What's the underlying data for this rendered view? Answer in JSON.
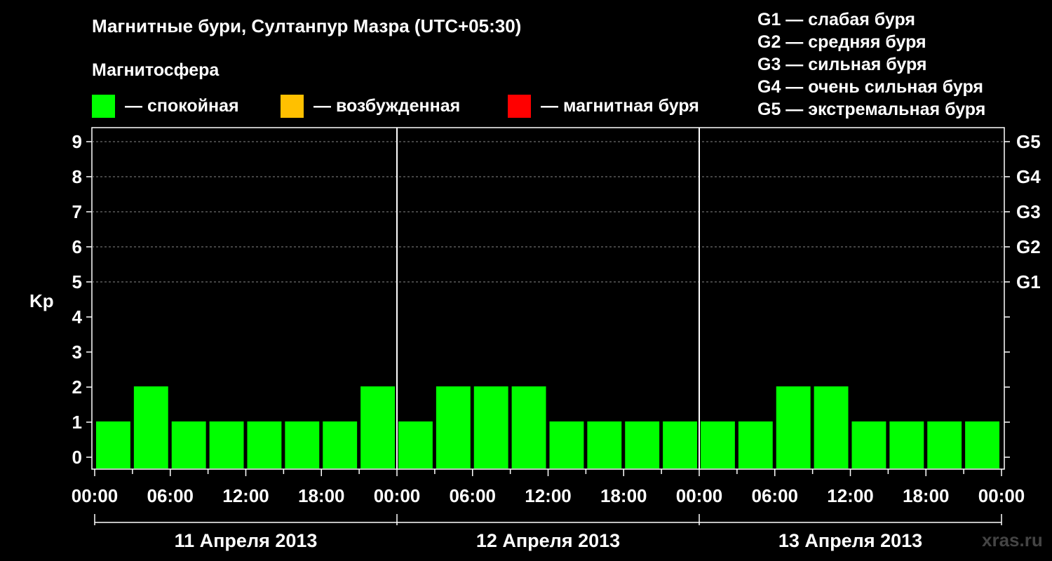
{
  "title": "Магнитные бури, Султанпур Мазра (UTC+05:30)",
  "magnetosphere_label": "Магнитосфера",
  "legend": [
    {
      "color": "#00ff00",
      "text": "— спокойная"
    },
    {
      "color": "#ffc000",
      "text": "— возбужденная"
    },
    {
      "color": "#ff0000",
      "text": "— магнитная буря"
    }
  ],
  "g_legend": [
    "G1 — слабая буря",
    "G2 — средняя буря",
    "G3 — сильная буря",
    "G4 — очень сильная буря",
    "G5 — экстремальная буря"
  ],
  "watermark": "xras.ru",
  "chart_data": {
    "type": "bar",
    "ylabel": "Kp",
    "ylim": [
      0,
      9
    ],
    "yticks": [
      0,
      1,
      2,
      3,
      4,
      5,
      6,
      7,
      8,
      9
    ],
    "right_ticks": [
      {
        "value": 5,
        "label": "G1"
      },
      {
        "value": 6,
        "label": "G2"
      },
      {
        "value": 7,
        "label": "G3"
      },
      {
        "value": 8,
        "label": "G4"
      },
      {
        "value": 9,
        "label": "G5"
      }
    ],
    "xlim_hours": [
      0,
      72
    ],
    "xtick_labels": [
      "00:00",
      "06:00",
      "12:00",
      "18:00",
      "00:00",
      "06:00",
      "12:00",
      "18:00",
      "00:00",
      "06:00",
      "12:00",
      "18:00",
      "00:00"
    ],
    "days": [
      "11 Апреля 2013",
      "12 Апреля 2013",
      "13 Апреля 2013"
    ],
    "interval_hours": 3,
    "start_hour_offset": 0,
    "values": [
      1,
      2,
      1,
      1,
      1,
      1,
      1,
      2,
      1,
      2,
      2,
      2,
      1,
      1,
      1,
      1,
      1,
      1,
      2,
      2,
      1,
      1,
      1,
      1
    ],
    "bar_color": "#00ff00",
    "grid": true
  }
}
